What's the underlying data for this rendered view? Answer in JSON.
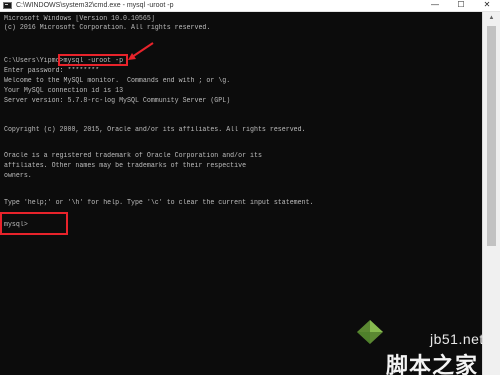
{
  "window": {
    "title": "C:\\WINDOWS\\system32\\cmd.exe - mysql  -uroot -p",
    "controls": {
      "minimize": "—",
      "maximize": "☐",
      "close": "✕"
    }
  },
  "console": {
    "lines": [
      "Microsoft Windows [Version 10.0.10565]",
      "(c) 2016 Microsoft Corporation. All rights reserved.",
      "",
      "C:\\Users\\Yipmo>mysql -uroot -p",
      "Enter password: ********",
      "Welcome to the MySQL monitor.  Commands end with ; or \\g.",
      "Your MySQL connection id is 13",
      "Server version: 5.7.8-rc-log MySQL Community Server (GPL)",
      "",
      "Copyright (c) 2000, 2015, Oracle and/or its affiliates. All rights reserved.",
      "",
      "Oracle is a registered trademark of Oracle Corporation and/or its",
      "affiliates. Other names may be trademarks of their respective",
      "owners.",
      "",
      "Type 'help;' or '\\h' for help. Type '\\c' to clear the current input statement.",
      "",
      "mysql>"
    ]
  },
  "watermark": {
    "site": "jb51.net",
    "name": "脚本之家"
  },
  "colors": {
    "console_bg": "#0c0c0c",
    "console_text": "#bdbdbd",
    "annotation_red": "#e8232b"
  }
}
